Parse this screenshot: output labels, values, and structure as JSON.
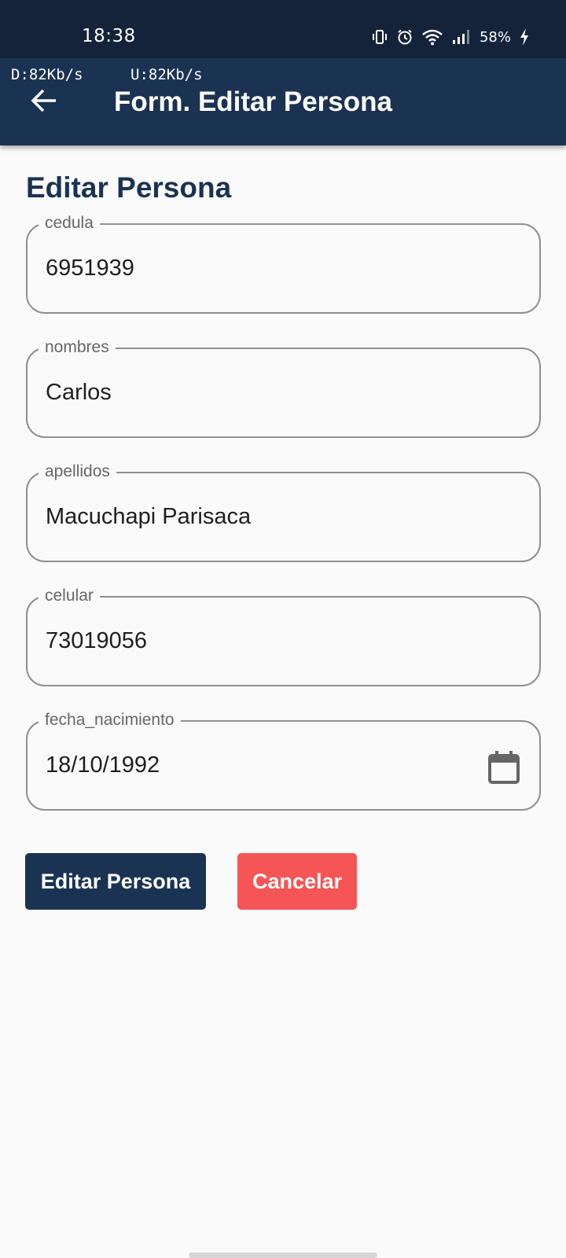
{
  "status_bar": {
    "time": "18:38",
    "battery": "58%",
    "icons": [
      "vibrate-icon",
      "alarm-icon",
      "wifi-icon",
      "signal-icon",
      "charging-bolt-icon"
    ]
  },
  "app_bar": {
    "download_speed": "D:82Kb/s",
    "upload_speed": "U:82Kb/s",
    "title": "Form. Editar Persona",
    "back_icon": "arrow-left-icon"
  },
  "form": {
    "title": "Editar Persona",
    "fields": [
      {
        "label": "cedula",
        "value": "6951939"
      },
      {
        "label": "nombres",
        "value": "Carlos"
      },
      {
        "label": "apellidos",
        "value": "Macuchapi Parisaca"
      },
      {
        "label": "celular",
        "value": "73019056"
      },
      {
        "label": "fecha_nacimiento",
        "value": "18/10/1992",
        "icon": "calendar-icon"
      }
    ]
  },
  "actions": {
    "edit_label": "Editar Persona",
    "cancel_label": "Cancelar"
  },
  "colors": {
    "status_bar_bg": "#14233a",
    "primary": "#1b3352",
    "danger": "#f55555",
    "background": "#fafafa",
    "field_border": "#8f8f8f"
  }
}
